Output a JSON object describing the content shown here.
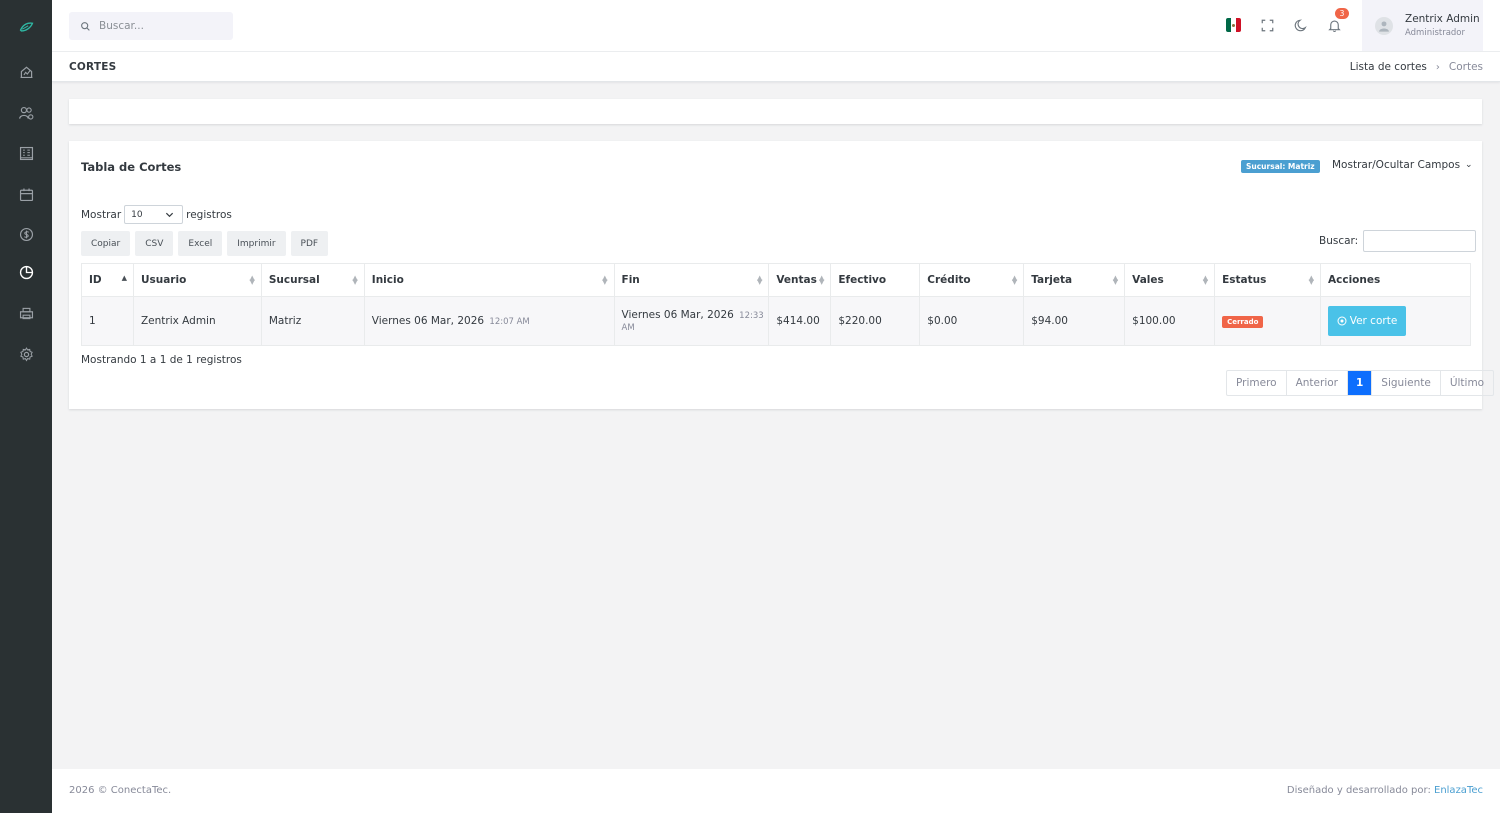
{
  "sidebar": {
    "logo_icon": "brand-leaf-icon",
    "items": [
      {
        "name": "dashboard",
        "icon": "chart-home-icon"
      },
      {
        "name": "users",
        "icon": "users-gear-icon"
      },
      {
        "name": "buildings",
        "icon": "building-icon"
      },
      {
        "name": "calendar",
        "icon": "calendar-icon"
      },
      {
        "name": "money",
        "icon": "money-icon"
      },
      {
        "name": "cortes",
        "icon": "pie-chart-icon",
        "active": true
      },
      {
        "name": "printer",
        "icon": "printer-icon"
      },
      {
        "name": "settings",
        "icon": "gear-icon"
      }
    ]
  },
  "topbar": {
    "search_placeholder": "Buscar...",
    "notifications_count": "3",
    "user": {
      "name": "Zentrix Admin",
      "role": "Administrador"
    },
    "flag_colors": [
      "#006847",
      "#ffffff",
      "#ce1126"
    ]
  },
  "page": {
    "title": "CORTES",
    "breadcrumb": {
      "parent": "Lista de cortes",
      "separator": "›",
      "current": "Cortes"
    }
  },
  "card": {
    "title": "Tabla de Cortes",
    "sucursal_badge": "Sucursal: Matriz",
    "toggle_fields_label": "Mostrar/Ocultar Campos",
    "show_label_before": "Mostrar",
    "show_value": "10",
    "show_label_after": "registros",
    "export_buttons": [
      "Copiar",
      "CSV",
      "Excel",
      "Imprimir",
      "PDF"
    ],
    "search_label": "Buscar:",
    "search_value": "",
    "columns": [
      "ID",
      "Usuario",
      "Sucursal",
      "Inicio",
      "Fin",
      "Ventas",
      "Efectivo",
      "Crédito",
      "Tarjeta",
      "Vales",
      "Estatus",
      "Acciones"
    ],
    "rows": [
      {
        "id": "1",
        "usuario": "Zentrix Admin",
        "sucursal": "Matriz",
        "inicio_date": "Viernes 06 Mar, 2026",
        "inicio_time": "12:07 AM",
        "fin_date": "Viernes 06 Mar, 2026",
        "fin_time": "12:33 AM",
        "ventas": "$414.00",
        "efectivo": "$220.00",
        "credito": "$0.00",
        "tarjeta": "$94.00",
        "vales": "$100.00",
        "estatus": "Cerrado",
        "accion": "Ver corte"
      }
    ],
    "info_text": "Mostrando 1 a 1 de 1 registros",
    "pagination": {
      "first": "Primero",
      "prev": "Anterior",
      "current": "1",
      "next": "Siguiente",
      "last": "Último"
    }
  },
  "footer": {
    "left": "2026 © ConectaTec.",
    "right_prefix": "Diseñado y desarrollado por: ",
    "right_link": "EnlazaTec"
  },
  "colors": {
    "sidebar_bg": "#2a3133",
    "accent_blue": "#0d6efd",
    "info_button": "#4ac2e8",
    "danger_badge": "#f06548",
    "sucursal_badge": "#4b9fd1"
  }
}
